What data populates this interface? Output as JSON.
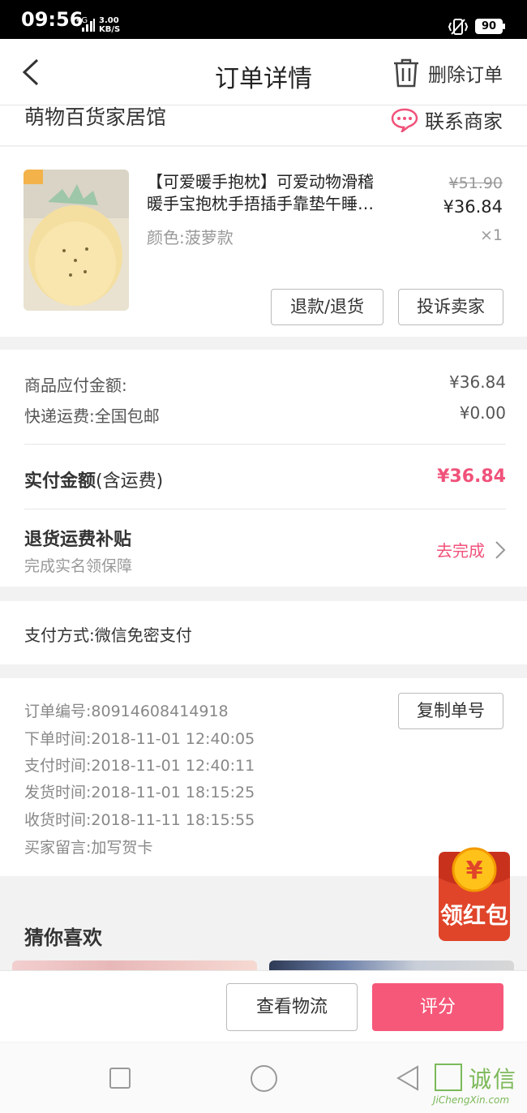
{
  "status_bar": {
    "time": "09:56",
    "network": "4G",
    "speed_value": "3.00",
    "speed_unit": "KB/S",
    "battery": "90"
  },
  "nav": {
    "title": "订单详情",
    "delete_label": "删除订单"
  },
  "shop": {
    "name": "萌物百货家居馆",
    "contact_label": "联系商家"
  },
  "product": {
    "name_line1": "【可爱暖手抱枕】可爱动物滑稽",
    "name_line2": "暖手宝抱枕手捂插手靠垫午睡…",
    "variant": "颜色:菠萝款",
    "original_price": "¥51.90",
    "price": "¥36.84",
    "quantity": "×1",
    "refund_button": "退款/退货",
    "complain_button": "投诉卖家"
  },
  "amount": {
    "goods_label": "商品应付金额:",
    "goods_value": "¥36.84",
    "shipping_label": "快递运费:全国包邮",
    "shipping_value": "¥0.00",
    "paid_label": "实付金额",
    "paid_label_note": "(含运费)",
    "paid_value": "¥36.84",
    "subsidy_title": "退货运费补贴",
    "subsidy_desc": "完成实名领保障",
    "subsidy_action": "去完成"
  },
  "payment": {
    "method": "支付方式:微信免密支付"
  },
  "order_info": {
    "order_no": "订单编号:80914608414918",
    "order_time": "下单时间:2018-11-01  12:40:05",
    "pay_time": "支付时间:2018-11-01  12:40:11",
    "ship_time": "发货时间:2018-11-01  18:15:25",
    "receive_time": "收货时间:2018-11-11  18:15:55",
    "buyer_note": "买家留言:加写贺卡",
    "copy_button": "复制单号"
  },
  "recommend": {
    "title": "猜你喜欢"
  },
  "red_packet": {
    "label": "领红包"
  },
  "actions": {
    "logistics_button": "查看物流",
    "rate_button": "评分"
  },
  "watermark": {
    "text": "诚信",
    "sub": "JiChengXin.com"
  },
  "colors": {
    "accent": "#f0527a",
    "rate_button": "#f6587a"
  }
}
